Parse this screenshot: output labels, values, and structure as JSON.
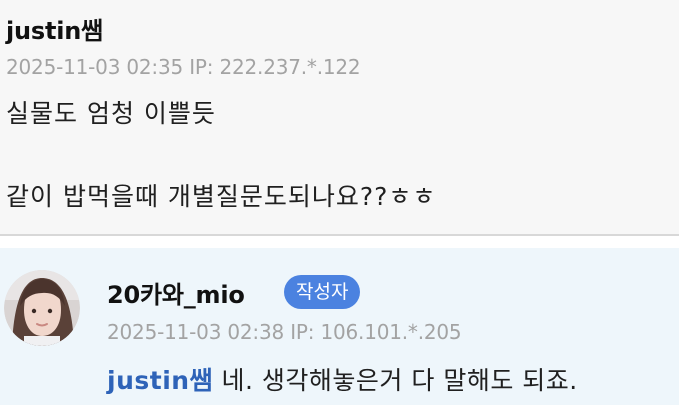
{
  "comment": {
    "author": "justin쌤",
    "date": "2025-11-03 02:35",
    "ip": "IP: 222.237.*.122",
    "lines": [
      "실물도 엄청 이쁠듯",
      "같이 밥먹을때 개별질문도되나요??ㅎㅎ"
    ]
  },
  "reply": {
    "author": "20카와_mio",
    "badge": "작성자",
    "date": "2025-11-03 02:38",
    "ip": "IP: 106.101.*.205",
    "mention": "justin쌤",
    "text": " 네. 생각해놓은거 다 말해도 되죠."
  },
  "colors": {
    "comment_bg": "#f7f7f7",
    "reply_bg": "#eef6fb",
    "badge_bg": "#4b82e0",
    "mention": "#2e63b8",
    "meta": "#a3a3a3"
  }
}
